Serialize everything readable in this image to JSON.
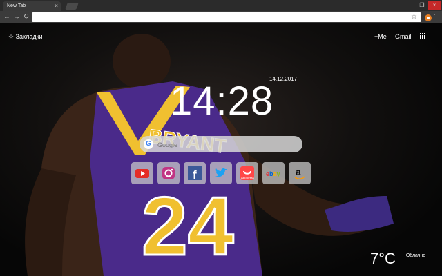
{
  "browser": {
    "tab_title": "New Tab",
    "tab_close": "×",
    "address_value": "",
    "window_controls": [
      "_",
      "❐",
      "×"
    ],
    "nav": {
      "back": "←",
      "forward": "→",
      "reload": "↻"
    },
    "star": "☆",
    "menu": "⋮"
  },
  "page": {
    "bookmarks_label": "Закладки",
    "bookmarks_icon": "star-icon",
    "plus_me": "+Me",
    "gmail": "Gmail",
    "apps_icon": "apps-grid-icon",
    "date": "14.12.2017",
    "time": "14:28",
    "search_placeholder": "Google",
    "tiles": [
      {
        "name": "youtube",
        "color": "#e52d27"
      },
      {
        "name": "instagram",
        "color": "#c13584"
      },
      {
        "name": "facebook",
        "color": "#3b5998"
      },
      {
        "name": "twitter",
        "color": "#1da1f2"
      },
      {
        "name": "aliexpress",
        "color": "#ff4747"
      },
      {
        "name": "ebay",
        "color": "#e53238"
      },
      {
        "name": "amazon",
        "color": "#111111"
      }
    ],
    "weather": {
      "temp": "7°C",
      "condition": "Облачно"
    }
  }
}
